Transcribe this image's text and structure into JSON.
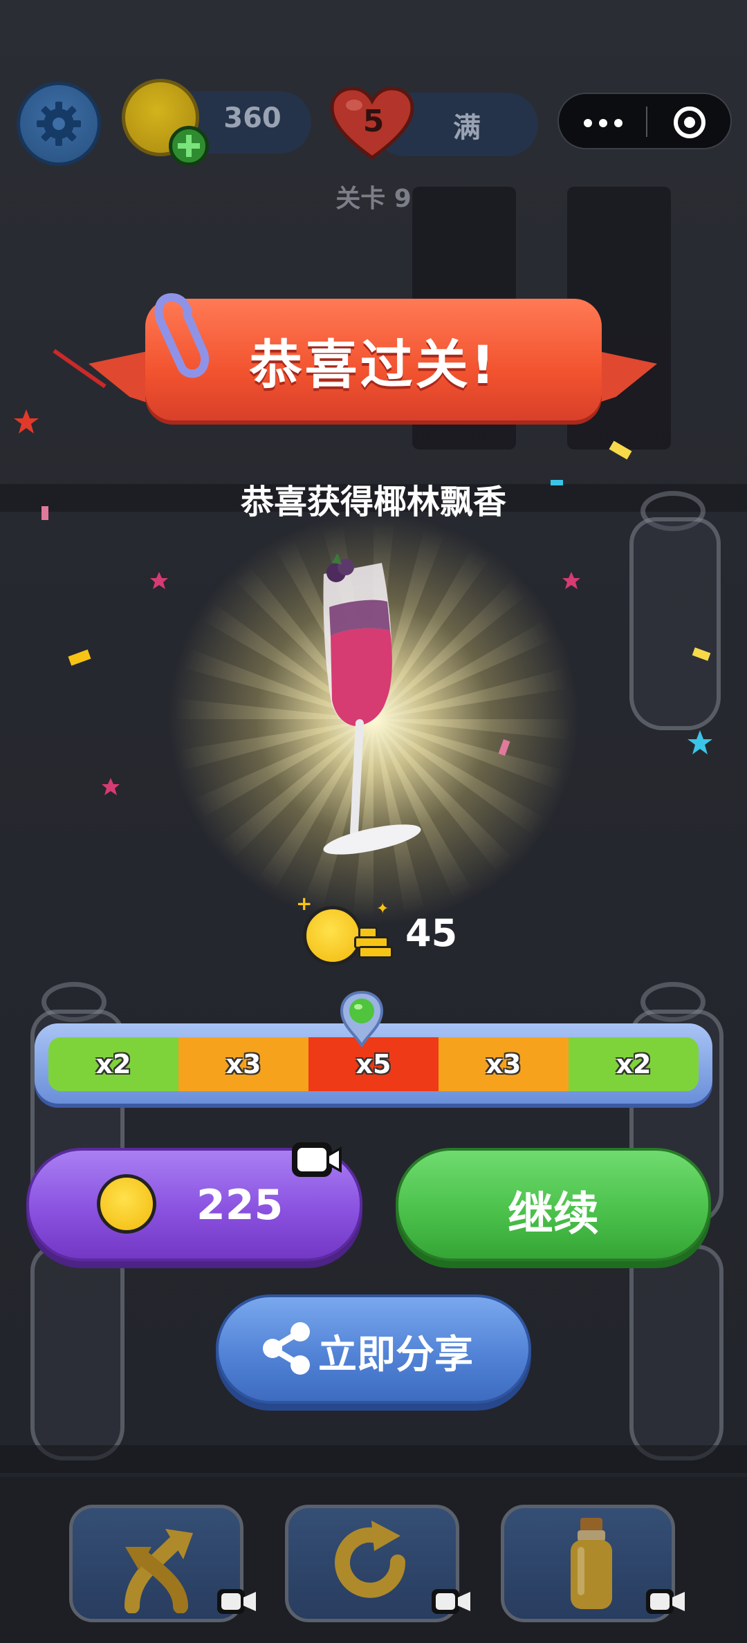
{
  "hud": {
    "settings_icon": "gear-icon",
    "coins": "360",
    "lives": "5",
    "lives_status": "满",
    "level_label": "关卡 9",
    "capsule": {
      "menu_icon": "more-dots-icon",
      "close_icon": "target-close-icon"
    }
  },
  "banner": {
    "title": "恭喜过关!"
  },
  "reward": {
    "text": "恭喜获得椰林飘香",
    "item_icon": "cocktail-glass-icon",
    "coins": "45"
  },
  "multiplier": {
    "segments": [
      {
        "label": "x2",
        "color": "#7fd33a"
      },
      {
        "label": "x3",
        "color": "#f7a21c"
      },
      {
        "label": "x5",
        "color": "#ee3a16"
      },
      {
        "label": "x3",
        "color": "#f7a21c"
      },
      {
        "label": "x2",
        "color": "#7fd33a"
      }
    ],
    "pointer_segment": 2
  },
  "buttons": {
    "ad_reward_amount": "225",
    "continue": "继续",
    "share": "立即分享"
  },
  "toolbar": {
    "tools": [
      {
        "icon": "swap-arrows-icon"
      },
      {
        "icon": "undo-icon"
      },
      {
        "icon": "add-bottle-icon"
      }
    ]
  },
  "colors": {
    "banner": "#f2532f",
    "continue": "#4cc24c",
    "ad_button": "#8a52e0",
    "share": "#5283d6"
  }
}
